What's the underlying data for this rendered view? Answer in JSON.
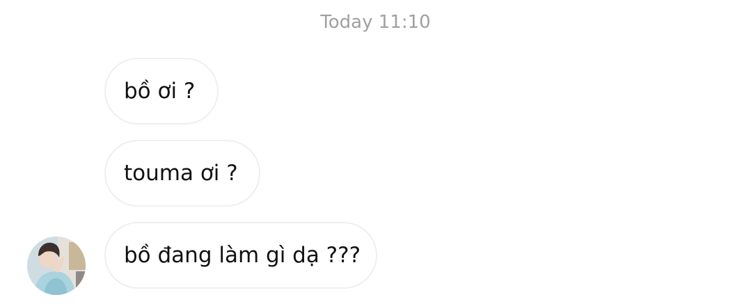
{
  "chat": {
    "timestamp": "Today 11:10",
    "messages": [
      {
        "text": "bồ ơi ?"
      },
      {
        "text": "touma ơi ?"
      },
      {
        "text": "bồ đang làm gì dạ ???"
      }
    ],
    "sender_avatar": {
      "icon": "user-avatar-photo"
    }
  },
  "colors": {
    "background": "#ffffff",
    "bubble_border": "#efefef",
    "timestamp_text": "#a0a0a0",
    "message_text": "#111111"
  }
}
